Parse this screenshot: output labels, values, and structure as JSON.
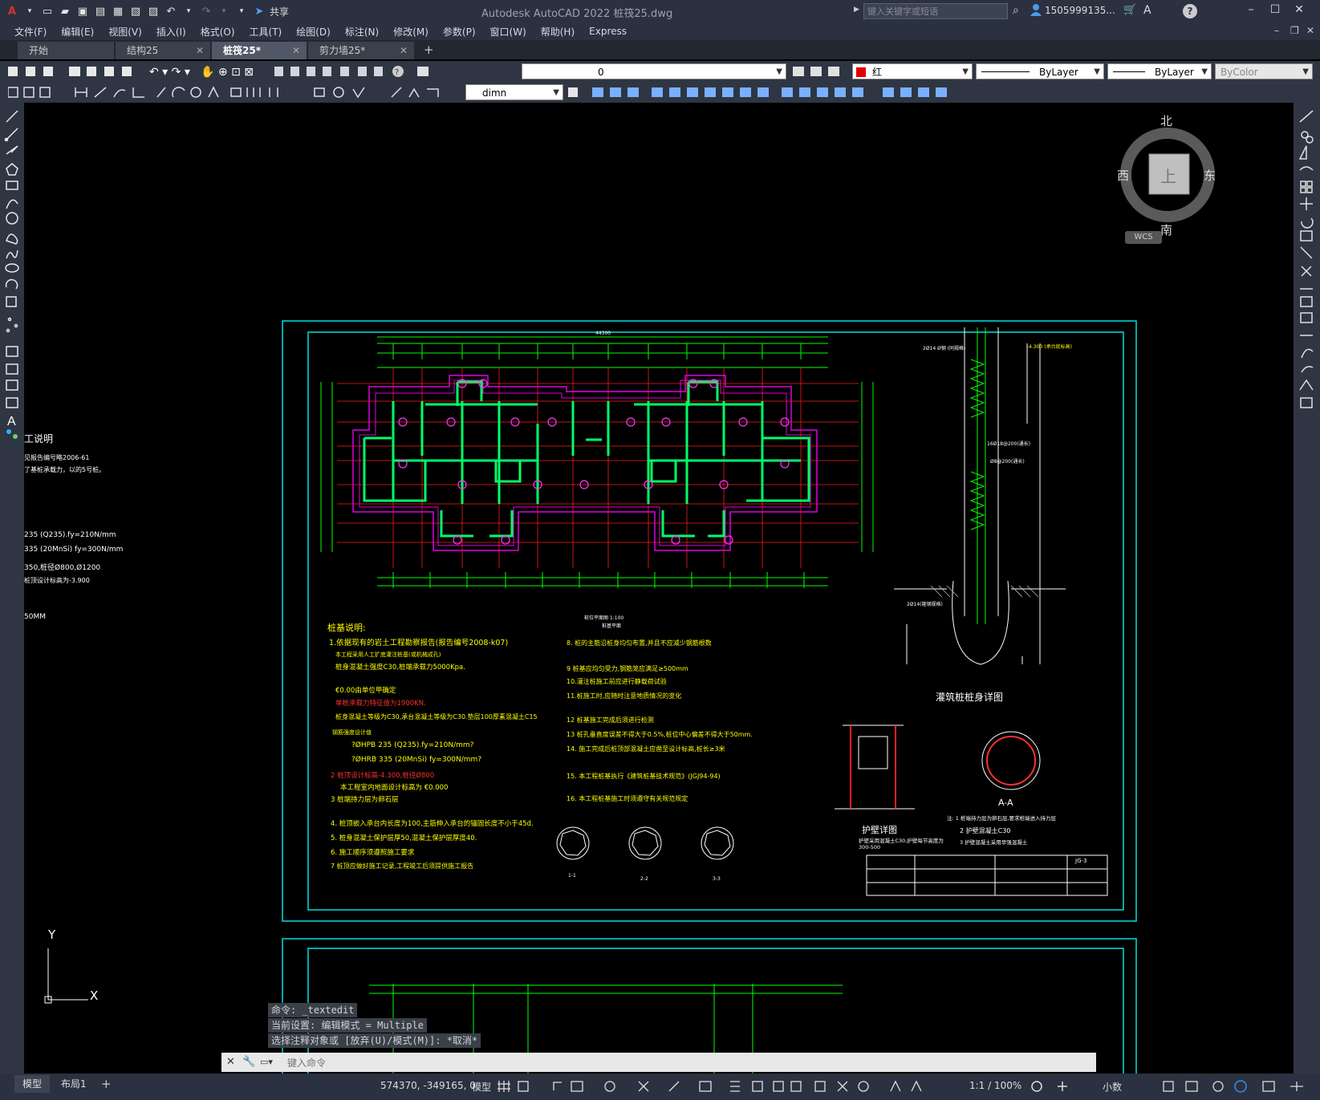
{
  "title_bar": {
    "app_title": "Autodesk AutoCAD 2022    桩筏25.dwg",
    "share_label": "共享",
    "search_placeholder": "键入关键字或短语",
    "user": "1505999135..."
  },
  "menu": [
    "文件(F)",
    "编辑(E)",
    "视图(V)",
    "插入(I)",
    "格式(O)",
    "工具(T)",
    "绘图(D)",
    "标注(N)",
    "修改(M)",
    "参数(P)",
    "窗口(W)",
    "帮助(H)",
    "Express"
  ],
  "tabs": [
    {
      "label": "开始",
      "active": false
    },
    {
      "label": "结构25",
      "active": false
    },
    {
      "label": "桩筏25*",
      "active": true
    },
    {
      "label": "剪力墙25*",
      "active": false
    }
  ],
  "toolbar": {
    "layer_value": "0",
    "color_value": "红",
    "linetype_value": "ByLayer",
    "lineweight_value": "ByLayer",
    "plotstyle_value": "ByColor",
    "dimstyle_value": "dimn"
  },
  "viewcube": {
    "north": "北",
    "south": "南",
    "east": "东",
    "west": "西",
    "top": "上",
    "wcs": "WCS"
  },
  "drawing": {
    "left_notes_title": "工说明",
    "left_notes": [
      "见报告编号略2006-61",
      "了基桩承载力，以的5号桩。",
      "235 (Q235).fy=210N/mm",
      "335 (20MnSi) fy=300N/mm",
      "350,桩径Ø800,Ø1200",
      "桩顶设计标高为-3.900",
      "50MM"
    ],
    "overall_dim": "44300",
    "pile_notes_title": "桩基说明:",
    "pile_notes": [
      "1.依据现有的岩土工程勘察报告(报告编号2008-k07)",
      "本工程采用人工扩底灌注桩基(或机械成孔)",
      "桩身混凝土强度C30,桩端承载力5000Kpa.",
      "€0.00由单位甲确定",
      "单桩承载力特征值为1900KN.",
      "桩身混凝土等级为C30,承台混凝土等级为C30.垫层100厚素混凝土C15",
      "钢筋强度设计值",
      "?ØHPB 235 (Q235).fy=210N/mm?",
      "?ØHRB 335 (20MnSi) fy=300N/mm?",
      "2 桩顶设计标高-4.300,桩径Ø800",
      "本工程室内地面设计标高为 €0.000",
      "3 桩端持力层为卵石层",
      "4. 桩顶嵌入承台内长度为100,主筋伸入承台的锚固长度不小于45d.",
      "5. 桩身混凝土保护层厚50,混凝土保护层厚度40.",
      "6. 施工顺序须遵照施工要求",
      "7 桩顶应做好施工记录,工程竣工后须提供施工报告"
    ],
    "pile_notes_right": [
      "8. 桩的主筋沿桩身均匀布置,并且不应减少钢筋根数",
      "9 桩基应均匀受力,钢筋笼应满足≥500mm",
      "10.灌注桩施工前应进行静载荷试验",
      "11.桩施工时,应随时注意地质情况的变化",
      "12 桩基施工完成后须进行检测",
      "13 桩孔垂直度误差不得大于0.5%,桩位中心偏差不得大于50mm.",
      "14. 施工完成后桩顶部混凝土应凿至设计标高,桩长≥3米",
      "15. 本工程桩基执行《建筑桩基技术规范》(JGJ94-94)",
      "16. 本工程桩基施工时须遵守有关规范规定"
    ],
    "plan_title": "桩位平面图 1:100",
    "plan_sub": "桩基平面",
    "pile_detail_title": "灌筑桩桩身详图",
    "pile_detail_label1": "2Ø14 Ø钢 (同规格)",
    "pile_detail_label2": "-4.300 (承台底标高)",
    "pile_detail_label3": "16Ø18@200(通长)",
    "pile_detail_label4": "Ø8@200(通长)",
    "pile_detail_label5": "2Ø14(箍钢规格)",
    "protect_title": "护壁详图",
    "protect_note": "护壁采用混凝土C30,护壁每节高度为300-500",
    "section_title": "A-A",
    "section_note1": "注: 1 桩端持力层为卵石层,要求桩端进入持力层",
    "section_note2": "2 护壁混凝土C30",
    "section_note3": "3 护壁混凝土采用早强混凝土",
    "small_sections": [
      "1-1",
      "2-2",
      "3-3"
    ],
    "drawing_no": "JG-3"
  },
  "command": {
    "history": [
      "命令:  _textedit",
      "当前设置: 编辑模式 = Multiple",
      "选择注释对象或 [放弃(U)/模式(M)]: *取消*"
    ],
    "input_placeholder": "键入命令"
  },
  "status": {
    "layout_tabs": [
      "模型",
      "布局1"
    ],
    "coords": "574370, -349165, 0",
    "model_label": "模型",
    "scale": "1:1 / 100%",
    "units": "小数"
  },
  "ucs": {
    "x": "X",
    "y": "Y"
  }
}
